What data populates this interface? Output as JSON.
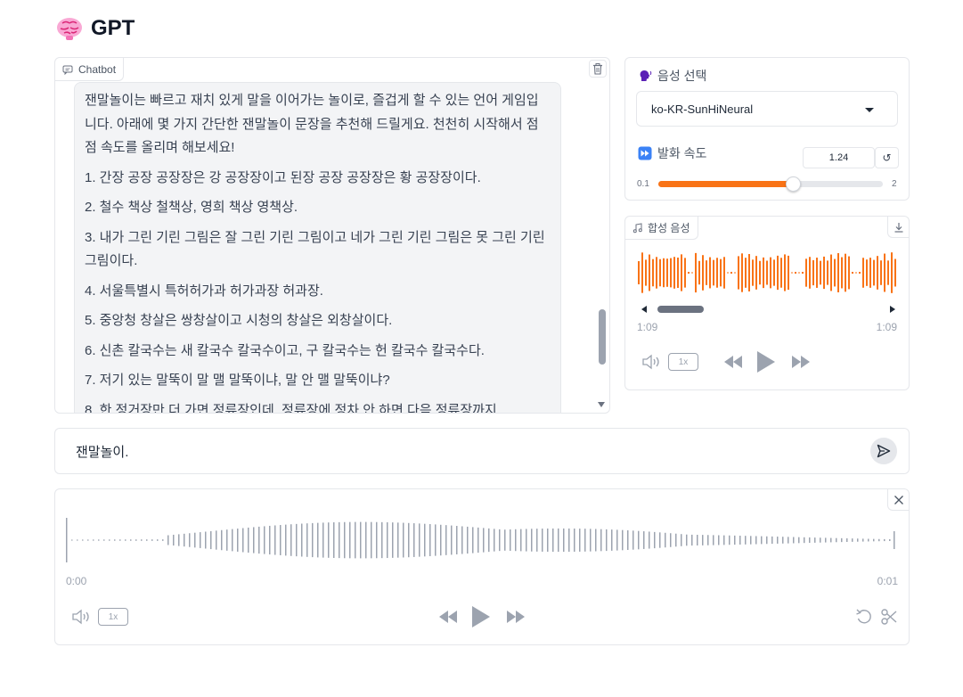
{
  "header": {
    "title": "GPT",
    "logo_icon": "brain-emoji"
  },
  "chatbot": {
    "label": "Chatbot",
    "message": {
      "intro": "잰말놀이는 빠르고 재치 있게 말을 이어가는 놀이로, 즐겁게 할 수 있는 언어 게임입니다. 아래에 몇 가지 간단한 잰말놀이 문장을 추천해 드릴게요. 천천히 시작해서 점점 속도를 올리며 해보세요!",
      "items": [
        "1. 간장 공장 공장장은 강 공장장이고 된장 공장 공장장은 황 공장장이다.",
        "2. 철수 책상 철책상, 영희 책상 영책상.",
        "3. 내가 그린 기린 그림은 잘 그린 기린 그림이고 네가 그린 기린 그림은 못 그린 기린 그림이다.",
        "4. 서울특별시 특허허가과 허가과장 허과장.",
        "5. 중앙청 창살은 쌍창살이고 시청의 창살은 외창살이다.",
        "6. 신촌 칼국수는 새 칼국수 칼국수이고, 구 칼국수는 헌 칼국수 칼국수다.",
        "7. 저기 있는 말뚝이 말 맬 말뚝이냐, 말 안 맬 말뚝이냐?",
        "8. 한 정거장만 더 가면 정류장인데, 정류장에 정차 안 하면 다음 정류장까지"
      ]
    }
  },
  "voice": {
    "label": "음성 선택",
    "selected": "ko-KR-SunHiNeural",
    "speed_label": "발화 속도",
    "speed_value": "1.24",
    "speed_min": "0.1",
    "speed_max": "2",
    "speed_fraction": 0.6
  },
  "synth": {
    "label": "합성 음성",
    "time_start": "1:09",
    "time_end": "1:09",
    "playback_rate": "1x"
  },
  "input": {
    "value": "잰말놀이."
  },
  "recording": {
    "time_start": "0:00",
    "time_end": "0:01",
    "playback_rate": "1x"
  },
  "colors": {
    "accent": "#f97316",
    "waveform_gray": "#9ca3af"
  }
}
